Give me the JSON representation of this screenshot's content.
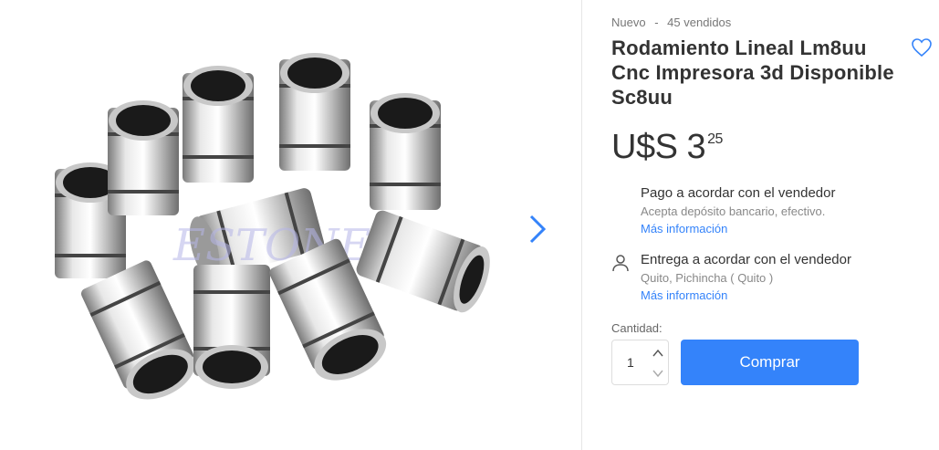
{
  "product": {
    "condition": "Nuevo",
    "separator": "-",
    "sold": "45 vendidos",
    "title": "Rodamiento Lineal Lm8uu Cnc Impresora 3d Disponible Sc8uu",
    "image_alt": "product-photo-linear-bearings",
    "watermark": "ESTONE"
  },
  "price": {
    "currency": "U$S",
    "amount": "3",
    "cents": "25"
  },
  "payment": {
    "title": "Pago a acordar con el vendedor",
    "detail": "Acepta depósito bancario, efectivo.",
    "more": "Más información"
  },
  "delivery": {
    "icon": "person-icon",
    "title": "Entrega a acordar con el vendedor",
    "detail": "Quito, Pichincha ( Quito )",
    "more": "Más información"
  },
  "quantity": {
    "label": "Cantidad:",
    "value": "1"
  },
  "buy": {
    "label": "Comprar"
  },
  "colors": {
    "accent": "#3483fa",
    "text": "#333333",
    "muted": "#888888"
  },
  "icons": {
    "favorite": "heart-outline-icon",
    "next": "chevron-right-icon",
    "qty_up": "chevron-up-icon",
    "qty_down": "chevron-down-icon"
  }
}
